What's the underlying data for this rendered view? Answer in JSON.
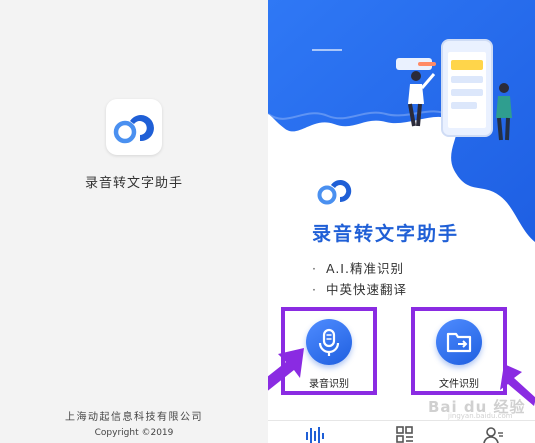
{
  "splash": {
    "logo_icon": "app-logo-icon",
    "app_name": "录音转文字助手",
    "company": "上海动起信息科技有限公司",
    "copyright": "Copyright ©2019"
  },
  "home": {
    "title": "录音转文字助手",
    "features": [
      {
        "bullet": "·",
        "text": "A.I.精准识别"
      },
      {
        "bullet": "·",
        "text": "中英快速翻译"
      }
    ],
    "actions": [
      {
        "label": "录音识别",
        "icon": "microphone-icon"
      },
      {
        "label": "文件识别",
        "icon": "folder-icon"
      }
    ],
    "tabs": [
      {
        "icon": "voice-wave-icon"
      },
      {
        "icon": "scan-icon"
      },
      {
        "icon": "user-icon"
      }
    ],
    "watermark": "Bai du 经验",
    "watermark_url": "jingyan.baidu.com"
  },
  "colors": {
    "accent": "#1f5fd6",
    "hero_blue": "#2a6cf0",
    "highlight": "#8a2be2",
    "splash_bg": "#f3f3f3"
  }
}
